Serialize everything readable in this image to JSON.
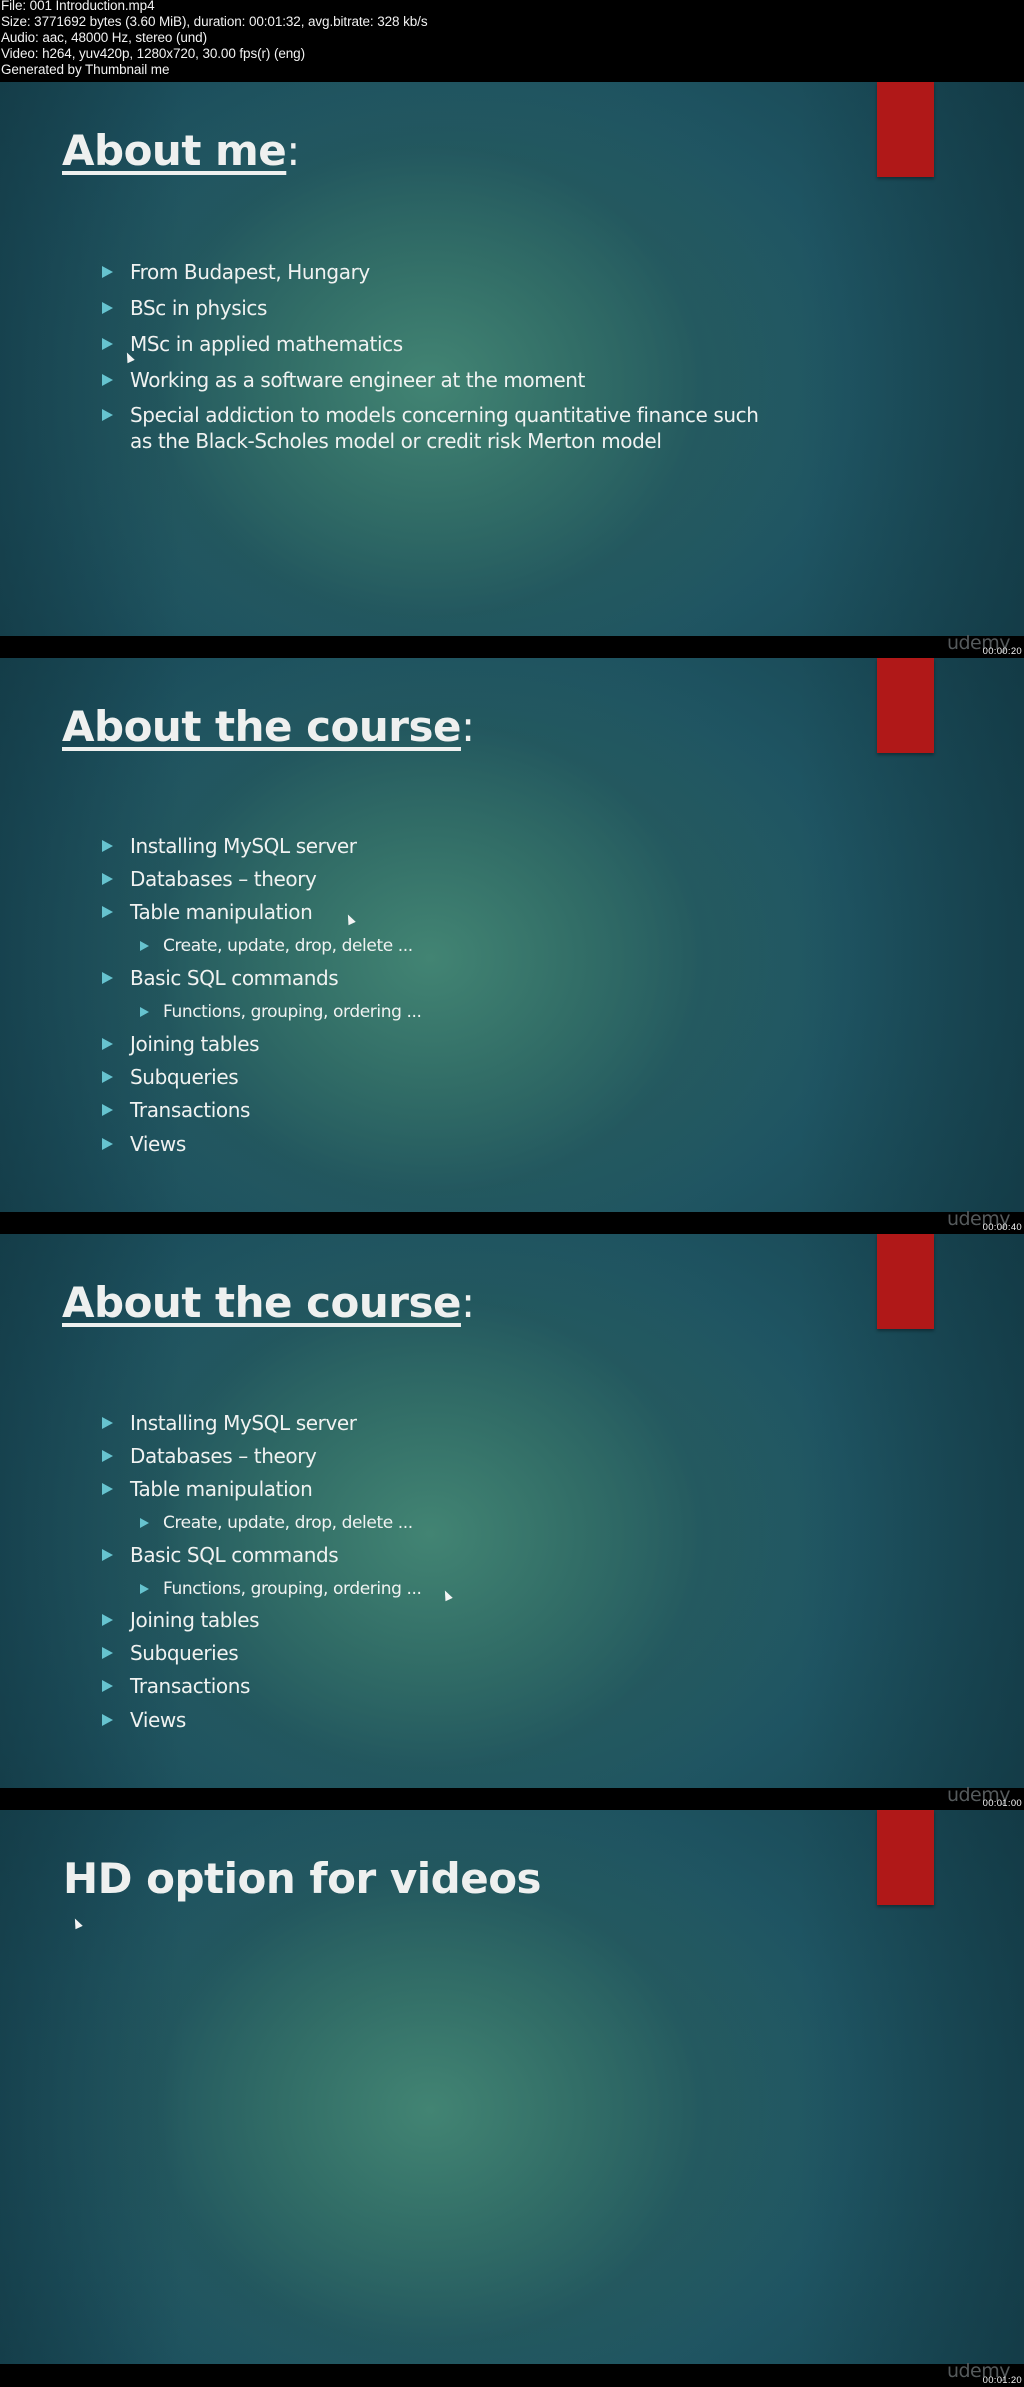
{
  "file_info": {
    "lines": [
      "File: 001 Introduction.mp4",
      "Size: 3771692 bytes (3.60 MiB), duration: 00:01:32, avg.bitrate: 328 kb/s",
      "Audio: aac, 48000 Hz, stereo (und)",
      "Video: h264, yuv420p, 1280x720, 30.00 fps(r) (eng)",
      "Generated by Thumbnail me"
    ]
  },
  "colors": {
    "accent_red": "#b01818",
    "bullet_arrow": "#66c3cf",
    "title_text": "#eef0ef",
    "background_center": "#3e7e70",
    "background_edge": "#133d4a"
  },
  "watermark": "udemy",
  "frames": [
    {
      "timestamp": "00:00:20",
      "title": {
        "text": "About me",
        "suffix": ":"
      },
      "bullets": [
        {
          "level": 1,
          "text": "From Budapest, Hungary"
        },
        {
          "level": 1,
          "text": "BSc in physics"
        },
        {
          "level": 1,
          "text": "MSc in applied mathematics"
        },
        {
          "level": 1,
          "text": "Working as a software engineer at the moment"
        },
        {
          "level": 1,
          "text": "Special addiction to models concerning quantitative finance such"
        },
        {
          "level": 0,
          "text": "as the Black-Scholes model or credit risk Merton model"
        }
      ]
    },
    {
      "timestamp": "00:00:40",
      "title": {
        "text": "About the course",
        "suffix": ":"
      },
      "bullets": [
        {
          "level": 1,
          "text": "Installing MySQL server"
        },
        {
          "level": 1,
          "text": "Databases – theory"
        },
        {
          "level": 1,
          "text": "Table manipulation"
        },
        {
          "level": 2,
          "text": "Create, update, drop, delete ..."
        },
        {
          "level": 1,
          "text": "Basic SQL commands"
        },
        {
          "level": 2,
          "text": "Functions, grouping, ordering ..."
        },
        {
          "level": 1,
          "text": "Joining tables"
        },
        {
          "level": 1,
          "text": "Subqueries"
        },
        {
          "level": 1,
          "text": "Transactions"
        },
        {
          "level": 1,
          "text": "Views"
        }
      ]
    },
    {
      "timestamp": "00:01:00",
      "title": {
        "text": "About the course",
        "suffix": ":"
      },
      "bullets": [
        {
          "level": 1,
          "text": "Installing MySQL server"
        },
        {
          "level": 1,
          "text": "Databases – theory"
        },
        {
          "level": 1,
          "text": "Table manipulation"
        },
        {
          "level": 2,
          "text": "Create, update, drop, delete ..."
        },
        {
          "level": 1,
          "text": "Basic SQL commands"
        },
        {
          "level": 2,
          "text": "Functions, grouping, ordering ..."
        },
        {
          "level": 1,
          "text": "Joining tables"
        },
        {
          "level": 1,
          "text": "Subqueries"
        },
        {
          "level": 1,
          "text": "Transactions"
        },
        {
          "level": 1,
          "text": "Views"
        }
      ]
    },
    {
      "timestamp": "00:01:20",
      "title": {
        "text": "HD option for videos",
        "suffix": ""
      },
      "bullets": []
    }
  ]
}
